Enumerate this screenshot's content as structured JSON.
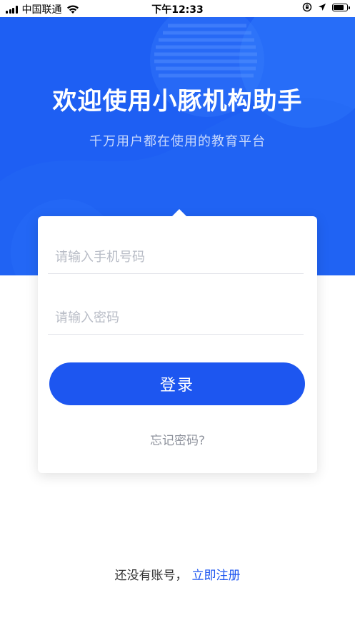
{
  "status_bar": {
    "carrier": "中国联通",
    "time": "下午12:33",
    "icons": [
      "signal-icon",
      "wifi-icon",
      "rotation-lock-icon",
      "location-arrow-icon",
      "battery-icon"
    ]
  },
  "hero": {
    "title": "欢迎使用小豚机构助手",
    "subtitle": "千万用户都在使用的教育平台"
  },
  "login_form": {
    "phone_placeholder": "请输入手机号码",
    "password_placeholder": "请输入密码",
    "login_label": "登录",
    "forgot_label": "忘记密码?"
  },
  "footer": {
    "no_account_text": "还没有账号，",
    "register_link": "立即注册"
  },
  "colors": {
    "brand": "#1e5ff3",
    "button": "#1d56f0",
    "link": "#1d56f0"
  }
}
